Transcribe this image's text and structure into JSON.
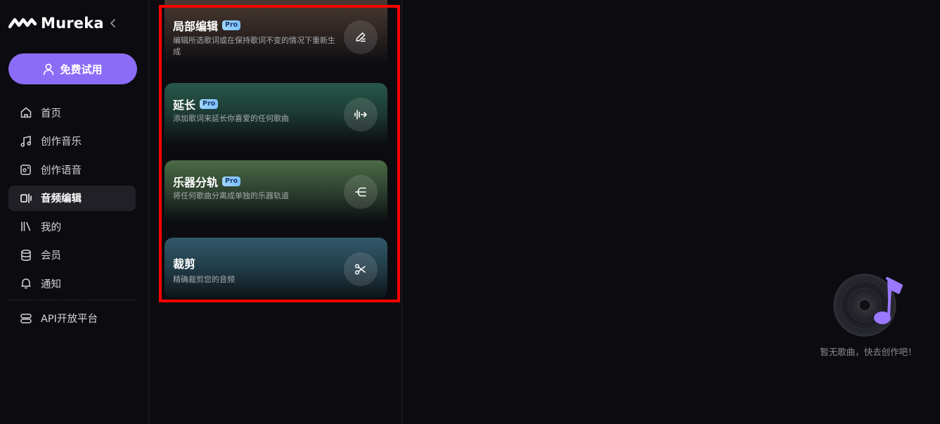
{
  "brand": {
    "name": "Mureka",
    "logo_icon": "mureka-wave-logo"
  },
  "sidebar": {
    "collapse_icon": "chevron-left-icon",
    "trial_button": {
      "label": "免费试用",
      "icon": "user-icon"
    },
    "items": [
      {
        "label": "首页",
        "icon": "home-icon"
      },
      {
        "label": "创作音乐",
        "icon": "music-note-icon"
      },
      {
        "label": "创作语音",
        "icon": "voice-icon"
      },
      {
        "label": "音频编辑",
        "icon": "audio-edit-icon",
        "active": true
      },
      {
        "label": "我的",
        "icon": "library-icon"
      },
      {
        "label": "会员",
        "icon": "database-icon"
      },
      {
        "label": "通知",
        "icon": "bell-icon"
      }
    ],
    "api_item": {
      "label": "API开放平台",
      "icon": "server-icon"
    }
  },
  "tools": {
    "cards": [
      {
        "title": "局部编辑",
        "badge": "Pro",
        "desc": "编辑所选歌词或在保持歌词不变的情况下重新生成",
        "icon": "pen-edit-icon"
      },
      {
        "title": "延长",
        "badge": "Pro",
        "desc": "添加歌词来延长你喜爱的任何歌曲",
        "icon": "waveform-arrow-icon"
      },
      {
        "title": "乐器分轨",
        "badge": "Pro",
        "desc": "将任何歌曲分离成单独的乐器轨道",
        "icon": "split-tracks-icon"
      },
      {
        "title": "裁剪",
        "badge": "",
        "desc": "精确裁剪您的音频",
        "icon": "scissors-icon"
      }
    ]
  },
  "empty_state": {
    "text": "暂无歌曲，快去创作吧！",
    "icon": "vinyl-music-icon"
  },
  "colors": {
    "accent": "#8b6cf6",
    "highlight": "#ff0000",
    "background": "#0c0c10"
  }
}
